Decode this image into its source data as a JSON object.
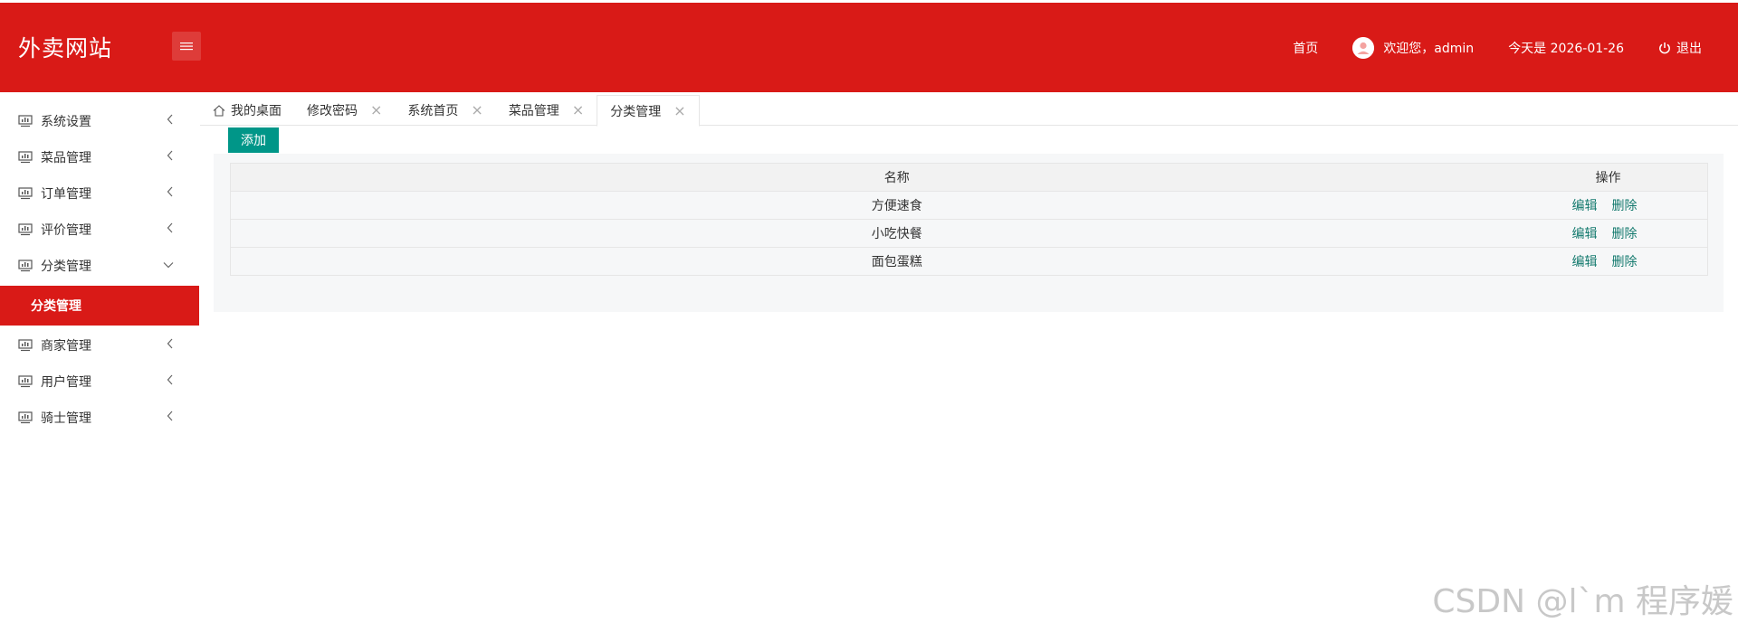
{
  "header": {
    "brand": "外卖网站",
    "nav": {
      "home": "首页",
      "welcome": "欢迎您，admin",
      "date": "今天是 2026-01-26",
      "logout": "退出"
    },
    "colors": {
      "bg": "#d91a17",
      "text": "#ffffff"
    }
  },
  "sidebar": {
    "items": [
      {
        "label": "系统设置",
        "icon": "monitor-icon"
      },
      {
        "label": "菜品管理",
        "icon": "monitor-icon"
      },
      {
        "label": "订单管理",
        "icon": "monitor-icon"
      },
      {
        "label": "评价管理",
        "icon": "monitor-icon"
      },
      {
        "label": "分类管理",
        "icon": "monitor-icon",
        "expanded": true
      },
      {
        "label": "商家管理",
        "icon": "monitor-icon"
      },
      {
        "label": "用户管理",
        "icon": "monitor-icon"
      },
      {
        "label": "骑士管理",
        "icon": "monitor-icon"
      }
    ],
    "active_sub": "分类管理"
  },
  "tabs": [
    {
      "label": "我的桌面",
      "closable": false,
      "icon": "home-icon"
    },
    {
      "label": "修改密码",
      "closable": true
    },
    {
      "label": "系统首页",
      "closable": true
    },
    {
      "label": "菜品管理",
      "closable": true
    },
    {
      "label": "分类管理",
      "closable": true,
      "active": true
    }
  ],
  "toolbar": {
    "add_label": "添加",
    "add_color": "#009688"
  },
  "table": {
    "headers": {
      "name": "名称",
      "ops": "操作"
    },
    "rows": [
      {
        "name": "方便速食"
      },
      {
        "name": "小吃快餐"
      },
      {
        "name": "面包蛋糕"
      }
    ],
    "edit_label": "编辑",
    "delete_label": "删除"
  },
  "watermark": "CSDN @l`m 程序媛"
}
